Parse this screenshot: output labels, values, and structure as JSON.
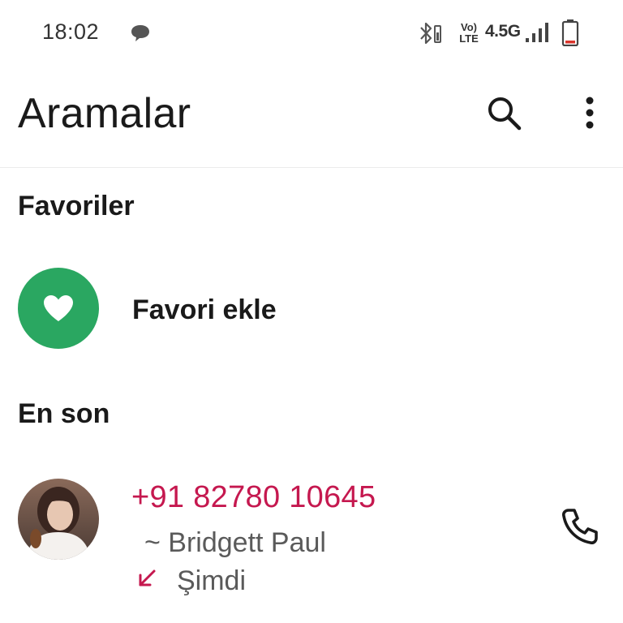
{
  "status_bar": {
    "time": "18:02",
    "volte_top": "Vo)",
    "volte_bottom": "LTE",
    "network_type": "4.5G",
    "icons": [
      "chat-icon",
      "bluetooth-icon",
      "volte-icon",
      "signal-icon",
      "battery-icon"
    ]
  },
  "header": {
    "title": "Aramalar",
    "actions": [
      "search-icon",
      "more-vert-icon"
    ]
  },
  "favorites": {
    "heading": "Favoriler",
    "add_label": "Favori ekle",
    "add_icon": "heart-icon",
    "icon_bg_color": "#2aa761"
  },
  "recent": {
    "heading": "En son",
    "calls": [
      {
        "number": "+91 82780 10645",
        "name": "~ Bridgett Paul",
        "time": "Şimdi",
        "type_icon": "incoming-call-arrow-icon",
        "action_icon": "phone-icon"
      }
    ],
    "number_color": "#c5184f"
  }
}
